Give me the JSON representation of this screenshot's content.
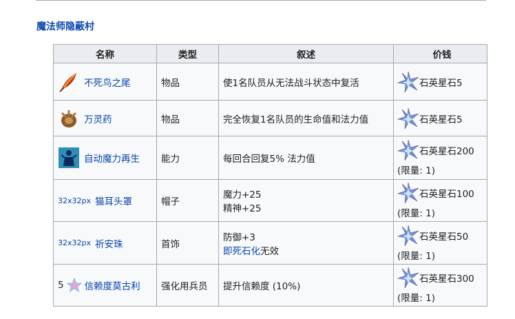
{
  "section_title": "魔法师隐蔽村",
  "headers": [
    "名称",
    "类型",
    "叙述",
    "价钱"
  ],
  "rows": [
    {
      "icon": "phoenix-feather-icon",
      "prefix": "",
      "name": "不死鸟之尾",
      "type": "物品",
      "desc_lines": [
        "使1名队员从无法战斗状态中复活"
      ],
      "price": "石英星石5",
      "limit": ""
    },
    {
      "icon": "elixir-icon",
      "prefix": "",
      "name": "万灵药",
      "type": "物品",
      "desc_lines": [
        "完全恢复1名队员的生命值和法力值"
      ],
      "price": "石英星石5",
      "limit": ""
    },
    {
      "icon": "auto-mp-regen-icon",
      "prefix": "",
      "name": "自动魔力再生",
      "type": "能力",
      "desc_lines": [
        "每回合回复5% 法力值"
      ],
      "price": "石英星石200",
      "limit": "(限量: 1)"
    },
    {
      "icon": "",
      "prefix": "32x32px",
      "name": "猫耳头罩",
      "type": "帽子",
      "desc_lines": [
        "魔力+25",
        "精神+25"
      ],
      "price": "石英星石100",
      "limit": "(限量: 1)"
    },
    {
      "icon": "",
      "prefix": "32x32px",
      "name": "祈安珠",
      "type": "首饰",
      "desc_lines": [
        "防御+3"
      ],
      "desc_link": "即死石化",
      "desc_tail": "无效",
      "price": "石英星石50",
      "limit": "(限量: 1)"
    },
    {
      "icon": "star-icon",
      "prefix": "5",
      "name": "信赖度莫古利",
      "type": "强化用兵员",
      "desc_lines": [
        "提升信赖度 (10%)"
      ],
      "price": "石英星石300",
      "limit": "(限量: 1)"
    }
  ],
  "colors": {
    "link": "#0645ad",
    "header_bg": "#eaecf0",
    "cell_bg": "#f8f9fa",
    "border": "#a2a9b1"
  }
}
